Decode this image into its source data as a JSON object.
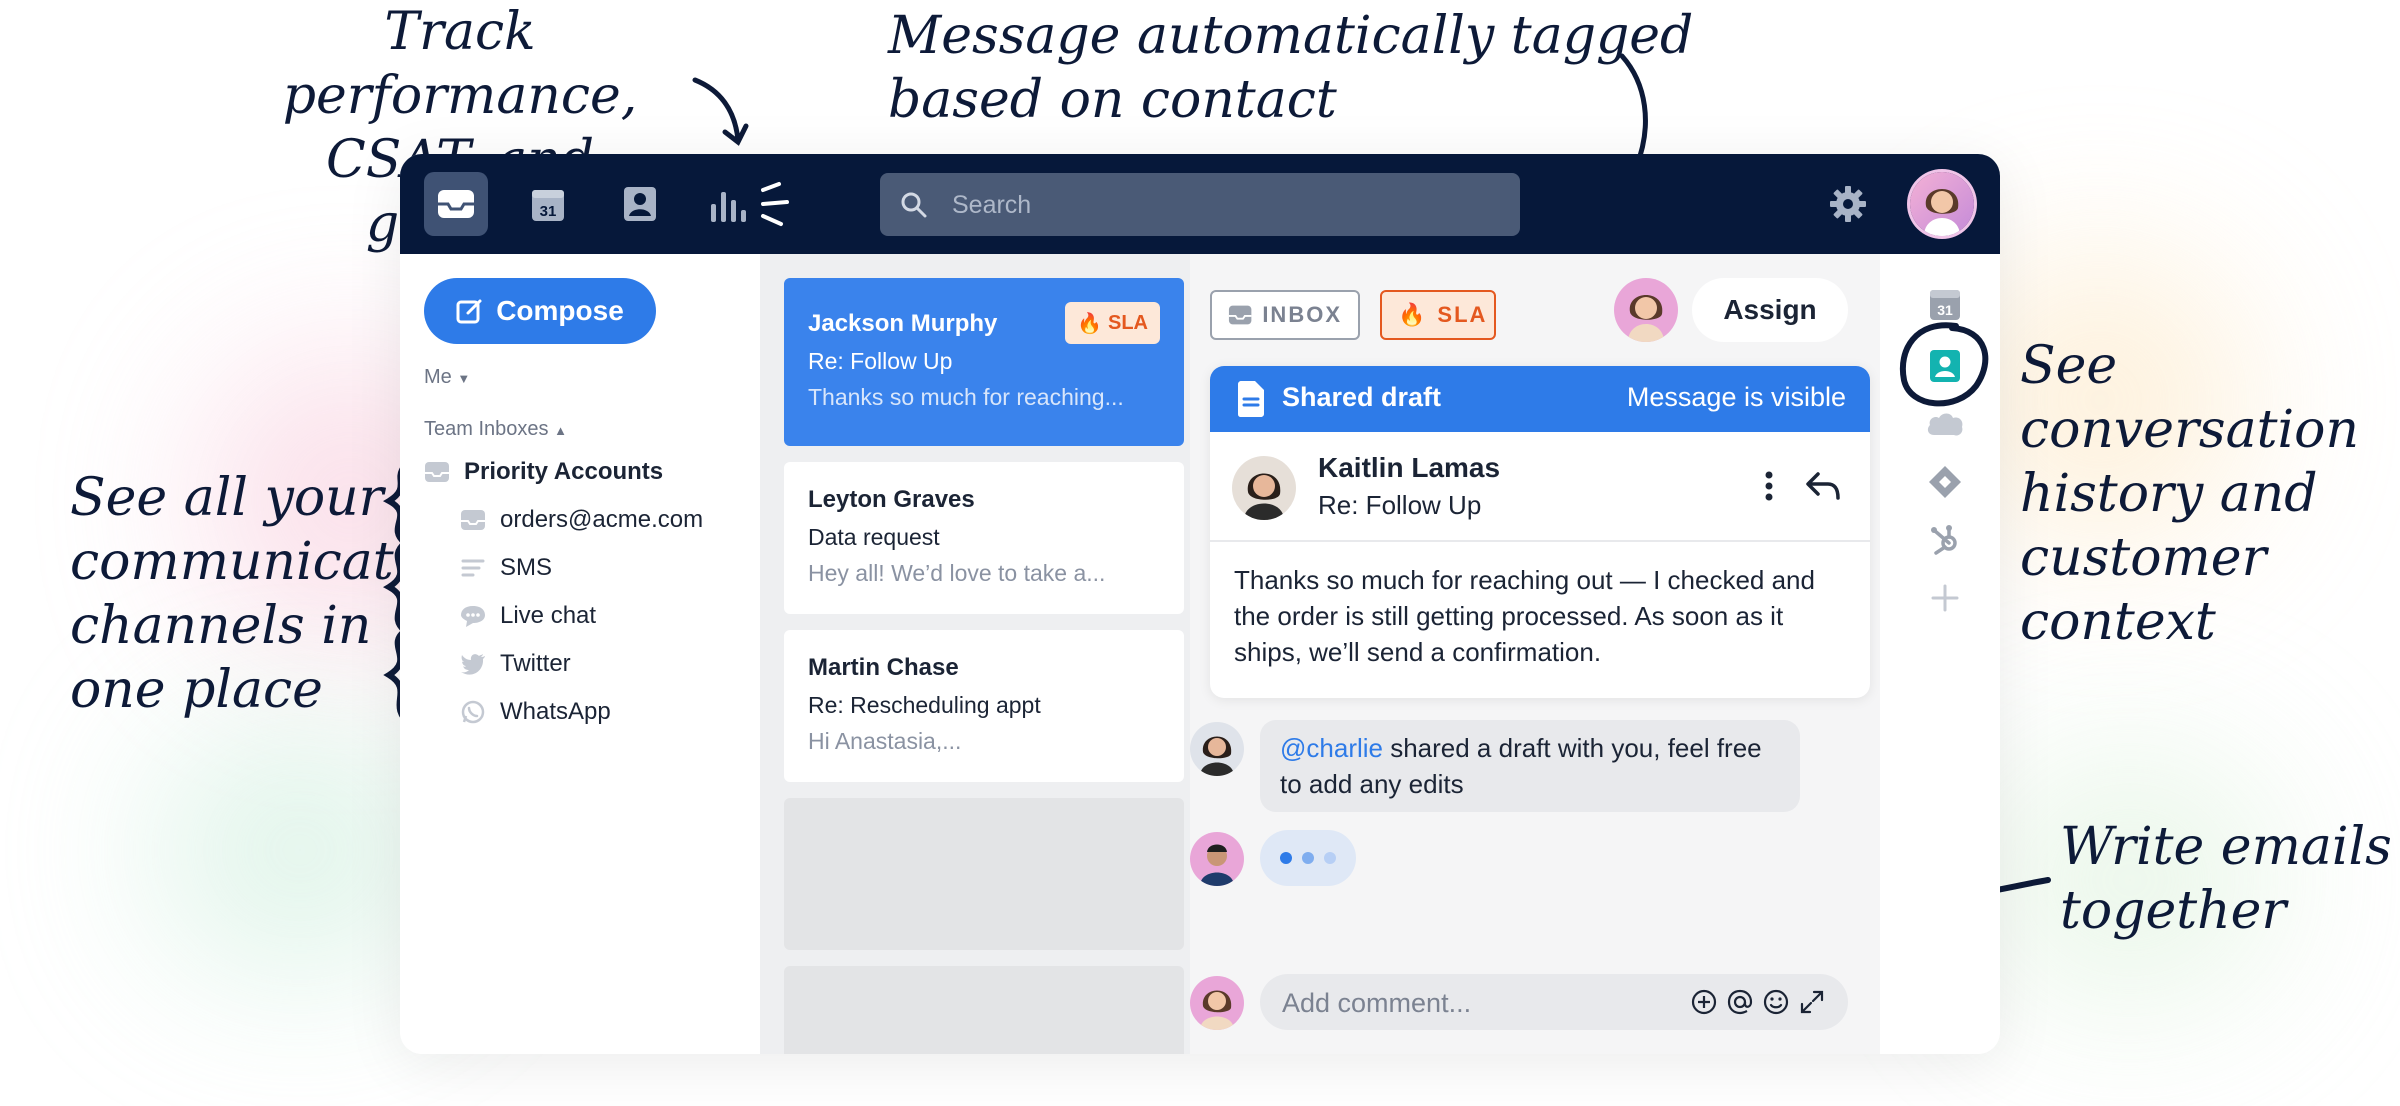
{
  "annotations": {
    "track": [
      "Track performance,",
      "CSAT, and growth"
    ],
    "tagged": [
      "Message automatically tagged",
      "based on contact"
    ],
    "history": [
      "See conversation",
      "history and",
      "customer context"
    ],
    "channels": [
      "See all your",
      "communication",
      "channels in",
      "one place"
    ],
    "write": [
      "Write emails",
      "together"
    ]
  },
  "topbar": {
    "search_placeholder": "Search",
    "nav_icons": [
      "inbox-icon",
      "calendar-icon",
      "contacts-icon",
      "analytics-icon"
    ],
    "calendar_day": "31"
  },
  "sidebar": {
    "compose_label": "Compose",
    "me_label": "Me",
    "team_inboxes_label": "Team Inboxes",
    "priority_label": "Priority Accounts",
    "channels": [
      {
        "label": "orders@acme.com",
        "icon": "inbox-icon"
      },
      {
        "label": "SMS",
        "icon": "sms-icon"
      },
      {
        "label": "Live chat",
        "icon": "chat-icon"
      },
      {
        "label": "Twitter",
        "icon": "twitter-icon"
      },
      {
        "label": "WhatsApp",
        "icon": "whatsapp-icon"
      }
    ]
  },
  "messages": [
    {
      "name": "Jackson Murphy",
      "subject": "Re: Follow Up",
      "preview": "Thanks so much for reaching...",
      "badge": "SLA"
    },
    {
      "name": "Leyton Graves",
      "subject": "Data request",
      "preview": "Hey all! We’d love to take a..."
    },
    {
      "name": "Martin Chase",
      "subject": "Re: Rescheduling appt",
      "preview": "Hi Anastasia,..."
    }
  ],
  "conversation": {
    "tag_inbox": "INBOX",
    "tag_sla": "SLA",
    "assign_label": "Assign",
    "draft_title": "Shared draft",
    "draft_visibility": "Message is visible",
    "draft_from": "Kaitlin Lamas",
    "draft_subject": "Re: Follow Up",
    "draft_body": "Thanks so much for reaching out — I checked and the order is still getting processed. As soon as it ships, we’ll send a confirmation.",
    "comment_mention": "@charlie",
    "comment_text": " shared a draft with you, feel free to add any edits",
    "comment_placeholder": "Add comment..."
  },
  "rail": {
    "calendar_day": "31",
    "icons": [
      "calendar-icon",
      "contact-icon",
      "salesforce-icon",
      "jira-icon",
      "hubspot-icon",
      "add-icon"
    ]
  },
  "colors": {
    "topbar": "#06183a",
    "accent": "#2e7be8",
    "sla": "#e4581f",
    "annotation_ink": "#0d1a38"
  }
}
